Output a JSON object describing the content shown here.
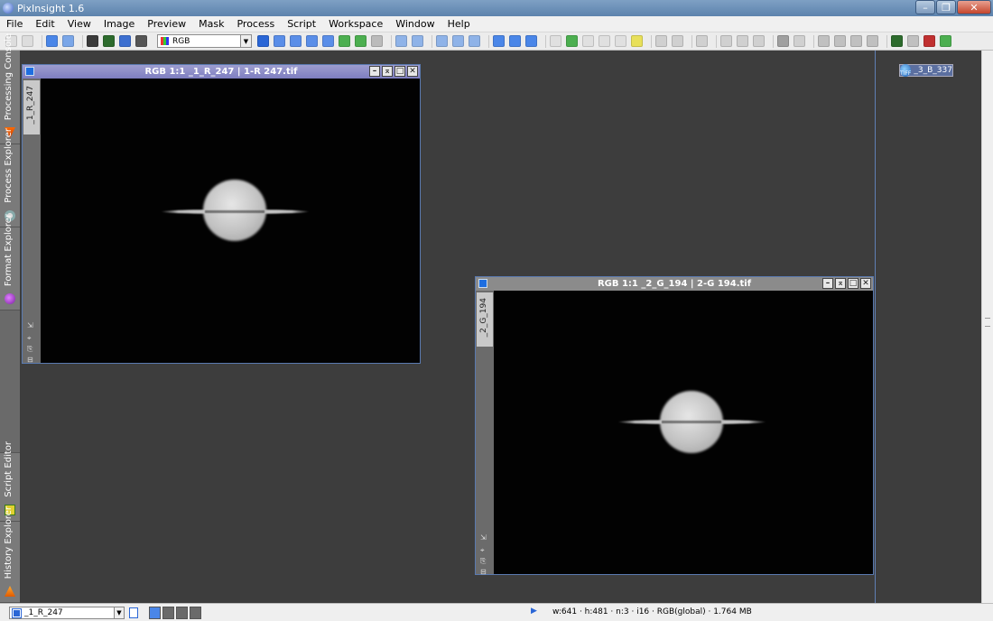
{
  "app": {
    "title": "PixInsight 1.6"
  },
  "menu": [
    "File",
    "Edit",
    "View",
    "Image",
    "Preview",
    "Mask",
    "Process",
    "Script",
    "Workspace",
    "Window",
    "Help"
  ],
  "toolbar": {
    "color_space": "RGB",
    "accent": "#1e6ee0"
  },
  "side_tabs": [
    {
      "label": "Processing Console",
      "icon": "processing-console-icon"
    },
    {
      "label": "Process Explorer",
      "icon": "gear-icon"
    },
    {
      "label": "Format Explorer",
      "icon": "format-explorer-icon"
    },
    {
      "label": "Script Editor",
      "icon": "script-editor-icon"
    },
    {
      "label": "History Explorer",
      "icon": "history-explorer-icon"
    }
  ],
  "windows": [
    {
      "title": "RGB 1:1 _1_R_247 | 1-R 247.tif",
      "view_id": "_1_R_247",
      "active": true
    },
    {
      "title": "RGB 1:1 _2_G_194 | 2-G 194.tif",
      "view_id": "_2_G_194",
      "active": false
    }
  ],
  "iconized": {
    "label": "_3_B_337",
    "badge": "TIFF"
  },
  "statusbar": {
    "view_selector": "_1_R_247",
    "info": "w:641 · h:481 · n:3 · i16 · RGB(global) · 1.764 MB"
  }
}
